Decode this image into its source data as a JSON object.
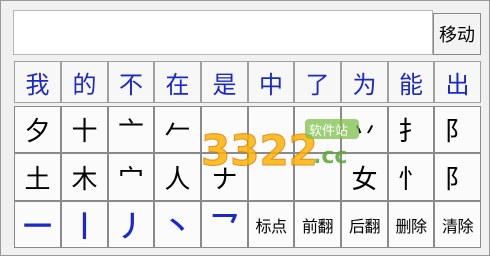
{
  "move_label": "移动",
  "frequent_chars": [
    "我",
    "的",
    "不",
    "在",
    "是",
    "中",
    "了",
    "为",
    "能",
    "出"
  ],
  "radicals_row1": [
    "夕",
    "十",
    "亠",
    "𠂉",
    "",
    "",
    "",
    "丷",
    "扌",
    "阝"
  ],
  "radicals_row2": [
    "土",
    "木",
    "宀",
    "人",
    "ナ",
    "",
    "",
    "女",
    "忄",
    "阝"
  ],
  "stroke_keys": [
    "一",
    "丨",
    "丿",
    "丶",
    "乛"
  ],
  "function_keys": [
    "标点",
    "前翻",
    "后翻",
    "删除",
    "清除"
  ],
  "watermark": {
    "number": "3322",
    "suffix": ".cc",
    "tag": "软件站"
  },
  "colors": {
    "blue": "#1a29c8"
  }
}
